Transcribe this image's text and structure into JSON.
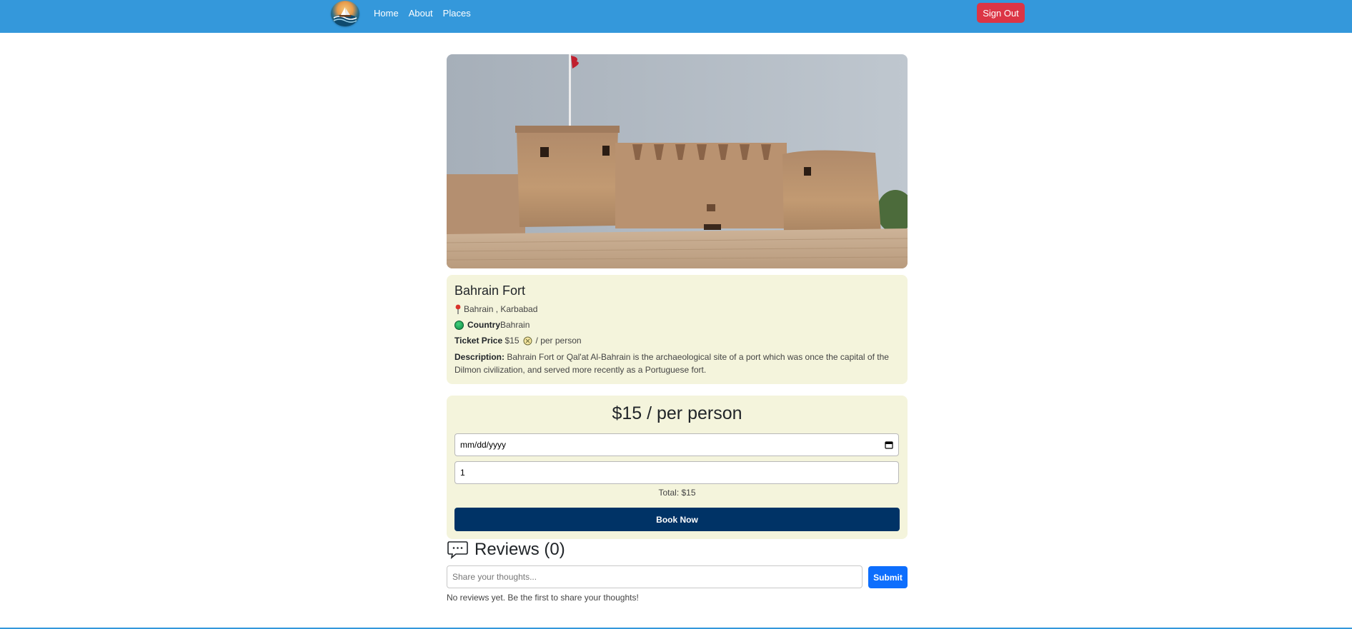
{
  "navbar": {
    "links": [
      "Home",
      "About",
      "Places"
    ],
    "sign_out_label": "Sign Out",
    "background_color": "#3498db"
  },
  "place": {
    "name": "Bahrain Fort",
    "location": "Bahrain , Karbabad",
    "country_label": "Country",
    "country_value": "Bahrain",
    "ticket_label": "Ticket Price",
    "ticket_price": "$15",
    "ticket_suffix": "/ per person",
    "description_label": "Description:",
    "description": "Bahrain Fort or Qal'at Al-Bahrain is the archaeological site of a port which was once the capital of the Dilmon civilization, and served more recently as a Portuguese fort."
  },
  "booking": {
    "price_heading": "$15 / per person",
    "date_placeholder": "mm/dd/yyyy",
    "quantity_value": "1",
    "total_text": "Total: $15",
    "book_button_label": "Book Now",
    "book_button_color": "#003366"
  },
  "reviews": {
    "title": "Reviews (0)",
    "input_placeholder": "Share your thoughts...",
    "submit_label": "Submit",
    "empty_text": "No reviews yet. Be the first to share your thoughts!"
  },
  "icons": {
    "location": "pin-icon",
    "country": "globe-icon",
    "ticket": "money-icon",
    "reviews": "chat-icon",
    "date": "calendar-icon"
  },
  "colors": {
    "card_background": "#f4f4dc",
    "sign_out": "#dc3545",
    "submit": "#0d6efd"
  }
}
